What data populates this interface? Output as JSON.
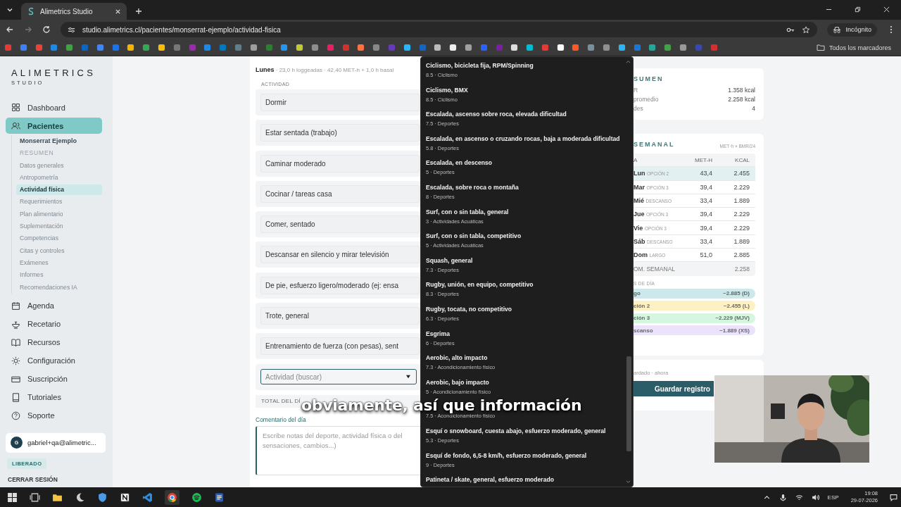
{
  "browser": {
    "tab_title": "Alimetrics Studio",
    "url": "studio.alimetrics.cl/pacientes/monserrat-ejemplo/actividad-fisica",
    "profile": "Incógnito",
    "bookmarks_folder": "Todos los marcadores"
  },
  "sidebar": {
    "logo": "ALIMETRICS",
    "logo_sub": "STUDIO",
    "nav_top": [
      {
        "label": "Dashboard",
        "selected": false
      },
      {
        "label": "Pacientes",
        "selected": true
      }
    ],
    "patient": "Monserrat Ejemplo",
    "sub_items": [
      {
        "label": "RESUMEN",
        "disabled": true,
        "selected": false
      },
      {
        "label": "Datos generales",
        "disabled": false,
        "selected": false
      },
      {
        "label": "Antropometría",
        "disabled": false,
        "selected": false
      },
      {
        "label": "Actividad física",
        "disabled": false,
        "selected": true
      },
      {
        "label": "Requerimientos",
        "disabled": false,
        "selected": false
      },
      {
        "label": "Plan alimentario",
        "disabled": false,
        "selected": false
      },
      {
        "label": "Suplementación",
        "disabled": false,
        "selected": false
      },
      {
        "label": "Competencias",
        "disabled": false,
        "selected": false
      },
      {
        "label": "Citas y controles",
        "disabled": false,
        "selected": false
      },
      {
        "label": "Exámenes",
        "disabled": false,
        "selected": false
      },
      {
        "label": "Informes",
        "disabled": false,
        "selected": false
      },
      {
        "label": "Recomendaciones IA",
        "disabled": false,
        "selected": false
      }
    ],
    "nav_bottom": [
      {
        "label": "Agenda",
        "selected": false
      },
      {
        "label": "Recetario",
        "selected": false
      },
      {
        "label": "Recursos",
        "selected": false
      },
      {
        "label": "Configuración",
        "selected": false
      },
      {
        "label": "Suscripción",
        "selected": false
      },
      {
        "label": "Tutoriales",
        "selected": false
      },
      {
        "label": "Soporte",
        "selected": false
      }
    ],
    "user": {
      "initial": "G",
      "email": "gabriel+qa@alimetric..."
    },
    "plan_badge": "LIBERADO",
    "logout": "CERRAR SESIÓN"
  },
  "day": {
    "name": "Lunes",
    "summary": "· 23,0 h loggeadas · 42,40 MET-h + 1,0 h basal",
    "column": "ACTIVIDAD",
    "activities": [
      "Dormir",
      "Estar sentada (trabajo)",
      "Caminar moderado",
      "Cocinar / tareas casa",
      "Comer, sentado",
      "Descansar en silencio y mirar televisión",
      "De pie, esfuerzo ligero/moderado (ej: ensa",
      "Trote, general",
      "Entrenamiento de fuerza (con pesas), sent"
    ],
    "search_placeholder": "Actividad (buscar)",
    "total_label": "TOTAL DEL DÍ",
    "comment_label": "Comentario del día",
    "comment_placeholder": "Escribe notas del deporte, actividad física o del\nsensaciones, cambios...)"
  },
  "dropdown": {
    "items": [
      {
        "title": "Ciclismo, bicicleta fija, RPM/Spinning",
        "meta": "8.5 · Ciclismo"
      },
      {
        "title": "Ciclismo, BMX",
        "meta": "8.5 · Ciclismo"
      },
      {
        "title": "Escalada, ascenso sobre roca, elevada dificultad",
        "meta": "7.5 · Deportes"
      },
      {
        "title": "Escalada, en ascenso o cruzando rocas, baja a moderada dificultad",
        "meta": "5.8 · Deportes"
      },
      {
        "title": "Escalada, en descenso",
        "meta": "5 · Deportes"
      },
      {
        "title": "Escalada, sobre roca o montaña",
        "meta": "8 · Deportes"
      },
      {
        "title": "Surf, con o sin tabla, general",
        "meta": "3 · Actividades Acuáticas"
      },
      {
        "title": "Surf, con o sin tabla, competitivo",
        "meta": "5 · Actividades Acuáticas"
      },
      {
        "title": "Squash, general",
        "meta": "7.3 · Deportes"
      },
      {
        "title": "Rugby, unión, en equipo, competitivo",
        "meta": "8.3 · Deportes"
      },
      {
        "title": "Rugby, tocata, no competitivo",
        "meta": "6.3 · Deportes"
      },
      {
        "title": "Esgrima",
        "meta": "6 · Deportes"
      },
      {
        "title": "Aerobic, alto impacto",
        "meta": "7.3 · Acondicionamiento físico"
      },
      {
        "title": "Aerobic, bajo impacto",
        "meta": "5 · Acondicionamiento físico"
      },
      {
        "meta": "7.5 · Acondicionamiento físico"
      },
      {
        "title": "Esquí o snowboard, cuesta abajo, esfuerzo moderado, general",
        "meta": "5.3 · Deportes"
      },
      {
        "title": "Esquí de fondo, 6,5-8 km/h, esfuerzo moderado, general",
        "meta": "9 · Deportes"
      },
      {
        "title": "Patineta / skate, general, esfuerzo moderado"
      }
    ]
  },
  "summary": {
    "title": "SUMEN",
    "rows": [
      {
        "label": "R",
        "value": "1.358 kcal"
      },
      {
        "label": "promedio",
        "value": "2.258 kcal"
      },
      {
        "label": "des",
        "value": "4"
      }
    ]
  },
  "weekly": {
    "title": "SEMANAL",
    "formula": "MET·h × BMR/24",
    "columns": [
      "A",
      "MET-H",
      "KCAL"
    ],
    "rows": [
      {
        "day": "Lun",
        "option": "OPCIÓN 2",
        "met": "43,4",
        "kcal": "2.455",
        "selected": true
      },
      {
        "day": "Mar",
        "option": "OPCIÓN 3",
        "met": "39,4",
        "kcal": "2.229",
        "selected": false
      },
      {
        "day": "Mié",
        "option": "DESCANSO",
        "met": "33,4",
        "kcal": "1.889",
        "selected": false
      },
      {
        "day": "Jue",
        "option": "OPCIÓN 3",
        "met": "39,4",
        "kcal": "2.229",
        "selected": false
      },
      {
        "day": "Vie",
        "option": "OPCIÓN 3",
        "met": "39,4",
        "kcal": "2.229",
        "selected": false
      },
      {
        "day": "Sáb",
        "option": "DESCANSO",
        "met": "33,4",
        "kcal": "1.889",
        "selected": false
      },
      {
        "day": "Dom",
        "option": "LARGO",
        "met": "51,0",
        "kcal": "2.885",
        "selected": false
      }
    ],
    "footer": {
      "label": "OM. SEMANAL",
      "value": "2.258"
    },
    "types_label": "S DE DÍA",
    "types": [
      {
        "name": "go",
        "value": "~2.885 (D)",
        "color": "#cde8ea"
      },
      {
        "name": "ción 2",
        "value": "~2.455 (L)",
        "color": "#fdf0c2"
      },
      {
        "name": "ción 3",
        "value": "~2.229 (MJV)",
        "color": "#d5f6df"
      },
      {
        "name": "scanso",
        "value": "~1.889 (XS)",
        "color": "#ebe2fb"
      }
    ]
  },
  "save": {
    "status": "ardado · ahora",
    "button": "Guardar registro"
  },
  "caption": "obviamente, así que información",
  "taskbar": {
    "lang": "ESP",
    "time": "19:08",
    "date": "29-07-2026"
  }
}
